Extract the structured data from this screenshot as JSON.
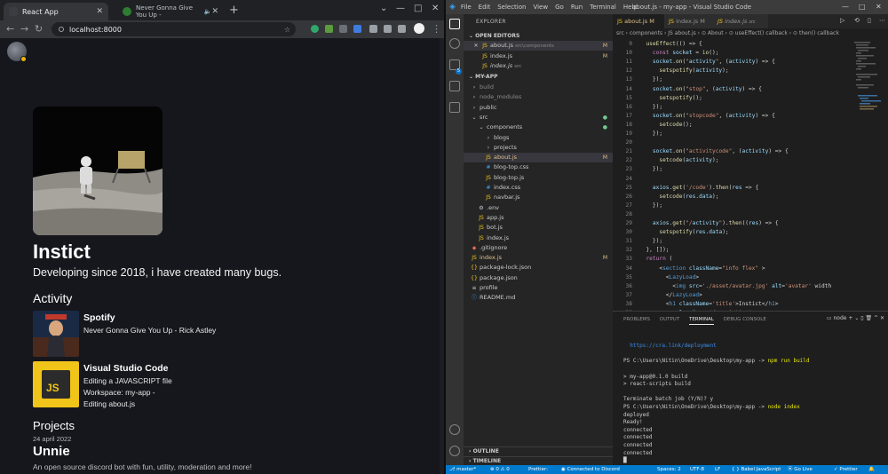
{
  "chrome": {
    "tabs": [
      {
        "title": "React App",
        "active": true
      },
      {
        "title": "Never Gonna Give You Up -",
        "active": false
      }
    ],
    "new_tab": "+",
    "url": "localhost:8000",
    "window_controls": [
      "⌄",
      "—",
      "□",
      "✕"
    ]
  },
  "page": {
    "name": "Instict",
    "description": "Developing since 2018, i have created many bugs.",
    "activity_heading": "Activity",
    "activities": [
      {
        "title": "Spotify",
        "lines": [
          "Never Gonna Give You Up - Rick Astley"
        ],
        "thumb_color": "#1a2a44"
      },
      {
        "title": "Visual Studio Code",
        "lines": [
          "Editing a JAVASCRIPT file",
          "Workspace: my-app -",
          "Editing about.js"
        ],
        "thumb_label": "JS",
        "thumb_color": "#f0c419"
      }
    ],
    "projects_heading": "Projects",
    "project_date": "24 april 2022",
    "project_title": "Unnie",
    "project_desc": "An open source discord bot with fun, utility, moderation and more!"
  },
  "vscode": {
    "menu": [
      "File",
      "Edit",
      "Selection",
      "View",
      "Go",
      "Run",
      "Terminal",
      "Help"
    ],
    "window_title": "about.js - my-app - Visual Studio Code",
    "explorer_label": "EXPLORER",
    "open_editors_label": "OPEN EDITORS",
    "open_editors": [
      {
        "name": "about.js",
        "path": "src\\components",
        "mark": "M",
        "close": "✕"
      },
      {
        "name": "index.js",
        "path": "",
        "mark": "M"
      },
      {
        "name": "index.js",
        "path": "src",
        "mark": ""
      }
    ],
    "project_label": "MY-APP",
    "tree": [
      {
        "name": "build",
        "icon": "›",
        "indent": 1
      },
      {
        "name": "node_modules",
        "icon": "›",
        "indent": 1
      },
      {
        "name": "public",
        "icon": "›",
        "indent": 1
      },
      {
        "name": "src",
        "icon": "⌄",
        "indent": 1,
        "mark": "●"
      },
      {
        "name": "components",
        "icon": "⌄",
        "indent": 2,
        "mark": "●"
      },
      {
        "name": "blogs",
        "icon": "›",
        "indent": 3
      },
      {
        "name": "projects",
        "icon": "›",
        "indent": 3
      },
      {
        "name": "about.js",
        "icon": "JS",
        "indent": 3,
        "mark": "M",
        "selected": true
      },
      {
        "name": "blog-top.css",
        "icon": "#",
        "indent": 3
      },
      {
        "name": "blog-top.js",
        "icon": "JS",
        "indent": 3
      },
      {
        "name": "index.css",
        "icon": "#",
        "indent": 3
      },
      {
        "name": "navbar.js",
        "icon": "JS",
        "indent": 3
      },
      {
        "name": ".env",
        "icon": "⚙",
        "indent": 2
      },
      {
        "name": "app.js",
        "icon": "JS",
        "indent": 2
      },
      {
        "name": "bot.js",
        "icon": "JS",
        "indent": 2
      },
      {
        "name": "index.js",
        "icon": "JS",
        "indent": 2
      },
      {
        "name": ".gitignore",
        "icon": "◆",
        "indent": 1
      },
      {
        "name": "index.js",
        "icon": "JS",
        "indent": 1,
        "mark": "M"
      },
      {
        "name": "package-lock.json",
        "icon": "{}",
        "indent": 1
      },
      {
        "name": "package.json",
        "icon": "{}",
        "indent": 1
      },
      {
        "name": "profile",
        "icon": "≡",
        "indent": 1
      },
      {
        "name": "README.md",
        "icon": "ⓘ",
        "indent": 1
      }
    ],
    "outline_label": "OUTLINE",
    "timeline_label": "TIMELINE",
    "editor_tabs": [
      {
        "name": "about.js",
        "mark": "M",
        "active": true
      },
      {
        "name": "index.js",
        "mark": "M",
        "active": false
      },
      {
        "name": "index.js",
        "mark": "src",
        "active": false
      }
    ],
    "breadcrumb": "src › components › JS about.js › ⊙ About › ⊙ useEffect() callback › ⊙ then() callback",
    "code_lines": [
      {
        "n": "9",
        "t": "  useEffect(() => {"
      },
      {
        "n": "10",
        "t": "    const socket = io();"
      },
      {
        "n": "11",
        "t": "    socket.on(\"activity\", (activity) => {"
      },
      {
        "n": "12",
        "t": "      setspotify(activity);"
      },
      {
        "n": "13",
        "t": "    });"
      },
      {
        "n": "14",
        "t": "    socket.on(\"stop\", (activity) => {"
      },
      {
        "n": "15",
        "t": "      setspotify();"
      },
      {
        "n": "16",
        "t": "    });"
      },
      {
        "n": "17",
        "t": "    socket.on(\"stopcode\", (activity) => {"
      },
      {
        "n": "18",
        "t": "      setcode();"
      },
      {
        "n": "19",
        "t": "    });"
      },
      {
        "n": "20",
        "t": ""
      },
      {
        "n": "21",
        "t": "    socket.on(\"activitycode\", (activity) => {"
      },
      {
        "n": "22",
        "t": "      setcode(activity);"
      },
      {
        "n": "23",
        "t": "    });"
      },
      {
        "n": "24",
        "t": ""
      },
      {
        "n": "25",
        "t": "    axios.get('/code').then(res => {"
      },
      {
        "n": "26",
        "t": "      setcode(res.data);"
      },
      {
        "n": "27",
        "t": "    });"
      },
      {
        "n": "28",
        "t": ""
      },
      {
        "n": "29",
        "t": "    axios.get(\"/activity\").then((res) => {"
      },
      {
        "n": "30",
        "t": "      setspotify(res.data);"
      },
      {
        "n": "31",
        "t": "    });"
      },
      {
        "n": "32",
        "t": "  }, []);"
      },
      {
        "n": "33",
        "t": "  return ("
      },
      {
        "n": "34",
        "t": "      <section className=\"info flex\" >"
      },
      {
        "n": "35",
        "t": "        <LazyLoad>"
      },
      {
        "n": "36",
        "t": "          <img src='./asset/avatar.jpg' alt='avatar' width"
      },
      {
        "n": "37",
        "t": "        </LazyLoad>"
      },
      {
        "n": "38",
        "t": "        <h1 className='title'>Instict</h1>"
      },
      {
        "n": "39",
        "t": "        <p className='description'>"
      }
    ],
    "panel_tabs": [
      "PROBLEMS",
      "OUTPUT",
      "TERMINAL",
      "DEBUG CONSOLE"
    ],
    "panel_active": "TERMINAL",
    "panel_shell": "node",
    "terminal_lines": [
      "",
      "",
      "  https://cra.link/deployment",
      "",
      "PS C:\\Users\\Nitin\\OneDrive\\Desktop\\my-app -> npm run build",
      "",
      "> my-app@0.1.0 build",
      "> react-scripts build",
      "",
      "Terminate batch job (Y/N)? y",
      "PS C:\\Users\\Nitin\\OneDrive\\Desktop\\my-app -> node index",
      "deployed",
      "Ready!",
      "connected",
      "connected",
      "connected",
      "connected",
      "█"
    ],
    "status": {
      "branch": "master*",
      "errors": "⊗ 0 ⚠ 0",
      "prettier": "Prettier:",
      "discord": "Connected to Discord",
      "spaces": "Spaces: 2",
      "encoding": "UTF-8",
      "eol": "LF",
      "language": "Babel JavaScript",
      "golive": "Go Live",
      "prettier_right": "✓ Prettier"
    }
  }
}
